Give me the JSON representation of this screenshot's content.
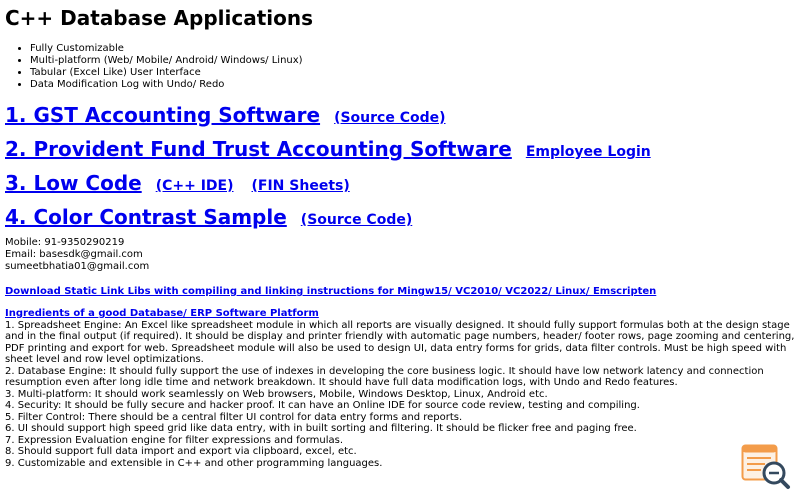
{
  "page": {
    "title": "C++ Database Applications"
  },
  "features": [
    "Fully Customizable",
    "Multi-platform (Web/ Mobile/ Android/ Windows/ Linux)",
    "Tabular (Excel Like) User Interface",
    "Data Modification Log with Undo/ Redo"
  ],
  "apps": [
    {
      "title": "1. GST Accounting Software",
      "links": [
        "(Source Code)"
      ]
    },
    {
      "title": "2. Provident Fund Trust Accounting Software",
      "links": [
        "Employee Login"
      ]
    },
    {
      "title": "3. Low Code",
      "links": [
        "(C++ IDE)",
        "(FIN Sheets)"
      ]
    },
    {
      "title": "4. Color Contrast Sample",
      "links": [
        "(Source Code)"
      ]
    }
  ],
  "contact": {
    "mobile": "Mobile: 91-9350290219",
    "email": "Email: basesdk@gmail.com",
    "email2": "sumeetbhatia01@gmail.com"
  },
  "download": {
    "label": "Download Static Link Libs with compiling and linking instructions for Mingw15/ VC2010/ VC2022/ Linux/ Emscripten"
  },
  "ingredients": {
    "title": "Ingredients of a good Database/ ERP Software Platform",
    "items": [
      "1. Spreadsheet Engine: An Excel like spreadsheet module in which all reports are visually designed. It should fully support formulas both at the design stage and in the final output (if required). It should be display and printer friendly with automatic page numbers, header/ footer rows, page zooming and centering, PDF printing and export for web. Spreadsheet module will also be used to design UI, data entry forms for grids, data filter controls. Must be high speed with sheet level and row level optimizations.",
      "2. Database Engine: It should fully support the use of indexes in developing the core business logic. It should have low network latency and connection resumption even after long idle time and network breakdown. It should have full data modification logs, with Undo and Redo features.",
      "3. Multi-platform: It should work seamlessly on Web browsers, Mobile, Windows Desktop, Linux, Android etc.",
      "4. Security: It should be fully secure and hacker proof. It can have an Online IDE for source code review, testing and compiling.",
      "5. Filter Control: There should be a central filter UI control for data entry forms and reports.",
      "6. UI should support high speed grid like data entry, with in built sorting and filtering. It should be flicker free and paging free.",
      "7. Expression Evaluation engine for filter expressions and formulas.",
      "8. Should support full data import and export via clipboard, excel, etc.",
      "9. Customizable and extensible in C++ and other programming languages."
    ]
  },
  "colors": {
    "link": "#0000ee",
    "text": "#000000",
    "logo_orange": "#f39c4a",
    "logo_dark": "#34495e"
  },
  "icons": {
    "corner_logo": "spreadsheet-magnifier-icon"
  }
}
